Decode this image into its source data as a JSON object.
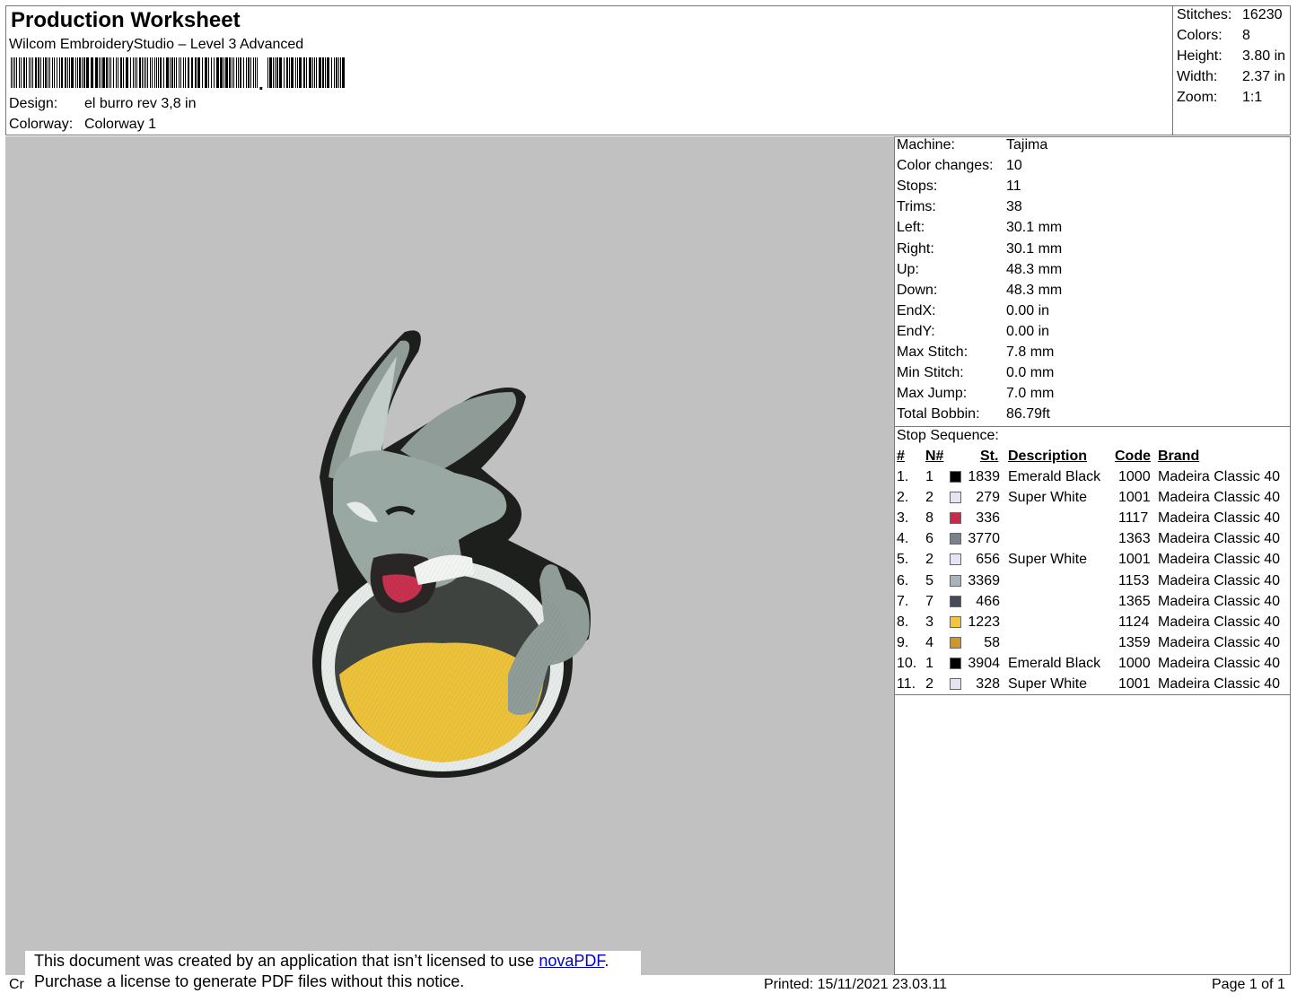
{
  "header": {
    "title": "Production Worksheet",
    "app": "Wilcom EmbroideryStudio – Level 3 Advanced",
    "design_label": "Design:",
    "design_value": "el burro rev 3,8 in",
    "colorway_label": "Colorway:",
    "colorway_value": "Colorway 1"
  },
  "stats": [
    {
      "label": "Stitches:",
      "value": "16230"
    },
    {
      "label": "Colors:",
      "value": "8"
    },
    {
      "label": "Height:",
      "value": "3.80 in"
    },
    {
      "label": "Width:",
      "value": "2.37 in"
    },
    {
      "label": "Zoom:",
      "value": "1:1"
    }
  ],
  "machine_info": [
    {
      "label": "Machine:",
      "value": "Tajima"
    },
    {
      "label": "Color changes:",
      "value": "10"
    },
    {
      "label": "Stops:",
      "value": "11"
    },
    {
      "label": "Trims:",
      "value": "38"
    },
    {
      "label": "Left:",
      "value": "30.1 mm"
    },
    {
      "label": "Right:",
      "value": "30.1 mm"
    },
    {
      "label": "Up:",
      "value": "48.3 mm"
    },
    {
      "label": "Down:",
      "value": "48.3 mm"
    },
    {
      "label": "EndX:",
      "value": "0.00 in"
    },
    {
      "label": "EndY:",
      "value": "0.00 in"
    },
    {
      "label": "Max Stitch:",
      "value": "7.8 mm"
    },
    {
      "label": "Min Stitch:",
      "value": "0.0 mm"
    },
    {
      "label": "Max Jump:",
      "value": "7.0 mm"
    },
    {
      "label": "Total Bobbin:",
      "value": "86.79ft"
    }
  ],
  "stop_sequence": {
    "title": "Stop Sequence:",
    "headers": {
      "num": "#",
      "n": "N#",
      "st": "St.",
      "desc": "Description",
      "code": "Code",
      "brand": "Brand"
    },
    "rows": [
      {
        "num": "1.",
        "n": "1",
        "color": "#000000",
        "st": "1839",
        "desc": "Emerald Black",
        "code": "1000",
        "brand": "Madeira Classic 40"
      },
      {
        "num": "2.",
        "n": "2",
        "color": "#e4e4f4",
        "st": "279",
        "desc": "Super White",
        "code": "1001",
        "brand": "Madeira Classic 40"
      },
      {
        "num": "3.",
        "n": "8",
        "color": "#c8284a",
        "st": "336",
        "desc": "",
        "code": "1117",
        "brand": "Madeira Classic 40"
      },
      {
        "num": "4.",
        "n": "6",
        "color": "#7a8290",
        "st": "3770",
        "desc": "",
        "code": "1363",
        "brand": "Madeira Classic 40"
      },
      {
        "num": "5.",
        "n": "2",
        "color": "#e4e4f4",
        "st": "656",
        "desc": "Super White",
        "code": "1001",
        "brand": "Madeira Classic 40"
      },
      {
        "num": "6.",
        "n": "5",
        "color": "#a8b4bc",
        "st": "3369",
        "desc": "",
        "code": "1153",
        "brand": "Madeira Classic 40"
      },
      {
        "num": "7.",
        "n": "7",
        "color": "#444a58",
        "st": "466",
        "desc": "",
        "code": "1365",
        "brand": "Madeira Classic 40"
      },
      {
        "num": "8.",
        "n": "3",
        "color": "#f2c440",
        "st": "1223",
        "desc": "",
        "code": "1124",
        "brand": "Madeira Classic 40"
      },
      {
        "num": "9.",
        "n": "4",
        "color": "#d0962a",
        "st": "58",
        "desc": "",
        "code": "1359",
        "brand": "Madeira Classic 40"
      },
      {
        "num": "10.",
        "n": "1",
        "color": "#000000",
        "st": "3904",
        "desc": "Emerald Black",
        "code": "1000",
        "brand": "Madeira Classic 40"
      },
      {
        "num": "11.",
        "n": "2",
        "color": "#e4e4f4",
        "st": "328",
        "desc": "Super White",
        "code": "1001",
        "brand": "Madeira Classic 40"
      }
    ]
  },
  "notice": {
    "line1_prefix": "This document was created by an application that isn’t licensed to use ",
    "link": "novaPDF",
    "line1_suffix": ".",
    "line2": "Purchase a license to generate PDF files without this notice."
  },
  "footer": {
    "left": "Cr",
    "printed": "Printed: 15/11/2021 23.03.11",
    "page": "Page 1 of 1"
  }
}
